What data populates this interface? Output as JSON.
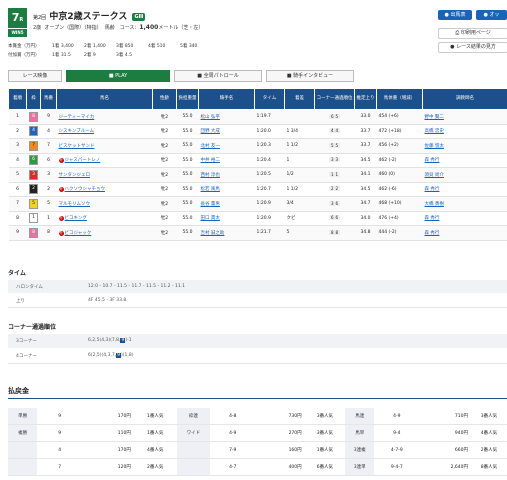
{
  "header": {
    "race_num": "7",
    "race_unit": "R",
    "badge": "WIN5",
    "kai": "第2回",
    "race_name": "中京2歳ステークス",
    "grade": "GⅢ",
    "age": "2歳",
    "cond": "オープン（国際）（特指）",
    "weight": "馬齢",
    "course_label": "コース：",
    "distance": "1,400",
    "unit": "メートル",
    "surface": "（芝・左）",
    "prize_label": "本賞金（万円）",
    "added_label": "付加賞（万円）",
    "prize": [
      {
        "rank": "1着",
        "val": "3,400"
      },
      {
        "rank": "2着",
        "val": "1,400"
      },
      {
        "rank": "3着",
        "val": "850"
      },
      {
        "rank": "4着",
        "val": "510"
      },
      {
        "rank": "5着",
        "val": "340"
      }
    ],
    "added": [
      {
        "rank": "1着",
        "val": "31.5"
      },
      {
        "rank": "2着",
        "val": "9"
      },
      {
        "rank": "3着",
        "val": "4.5"
      }
    ]
  },
  "buttons": {
    "entry": "出馬表",
    "odds": "オッ",
    "print": "印刷用ページ",
    "results_guide": "レース結果の見方"
  },
  "video": {
    "race_video": "レース映像",
    "play": "PLAY",
    "patrol": "全周パトロール",
    "interview": "騎手インタビュー"
  },
  "table": {
    "headers": [
      "着順",
      "枠",
      "馬番",
      "馬名",
      "性齢",
      "負担重量",
      "騎手名",
      "タイム",
      "着差",
      "コーナー通過順位",
      "推定上り",
      "馬体重（増減）",
      "調教師名"
    ],
    "rows": [
      {
        "rank": "1",
        "waku": "8",
        "num": "9",
        "name": "ジーティーマイカ",
        "sex": "牝2",
        "wt": "55.0",
        "jockey": "松山 弘平",
        "time": "1:19.7",
        "diff": "",
        "corner": [
          "6",
          "5"
        ],
        "last3f": "33.0",
        "body": "454 (+6)",
        "trainer": "野中 賢二",
        "icon": ""
      },
      {
        "rank": "2",
        "waku": "4",
        "num": "4",
        "name": "シスキンブルーム",
        "sex": "牝2",
        "wt": "55.0",
        "jockey": "団野 大成",
        "time": "1:20.0",
        "diff": "1 3/4",
        "corner": [
          "4",
          "4"
        ],
        "last3f": "33.7",
        "body": "472 (+18)",
        "trainer": "高橋 忠史",
        "icon": ""
      },
      {
        "rank": "3",
        "waku": "7",
        "num": "7",
        "name": "ビスケットサンド",
        "sex": "牝2",
        "wt": "55.0",
        "jockey": "北村 友一",
        "time": "1:20.3",
        "diff": "1 1/2",
        "corner": [
          "5",
          "5"
        ],
        "last3f": "33.7",
        "body": "456 (+2)",
        "trainer": "佐藤 悠太",
        "icon": ""
      },
      {
        "rank": "4",
        "waku": "6",
        "num": "6",
        "name": "ジャスパートレノ",
        "sex": "牡2",
        "wt": "55.0",
        "jockey": "中井 裕二",
        "time": "1:20.4",
        "diff": "1",
        "corner": [
          "3",
          "3"
        ],
        "last3f": "34.5",
        "body": "462 (-2)",
        "trainer": "森 秀行",
        "icon": "外"
      },
      {
        "rank": "5",
        "waku": "3",
        "num": "3",
        "name": "サンタンジェロ",
        "sex": "牝2",
        "wt": "55.0",
        "jockey": "西村 淳也",
        "time": "1:20.5",
        "diff": "1/2",
        "corner": [
          "1",
          "1"
        ],
        "last3f": "34.1",
        "body": "460 (0)",
        "trainer": "須貝 尚介",
        "icon": ""
      },
      {
        "rank": "6",
        "waku": "2",
        "num": "2",
        "name": "ハクソウシャチョウ",
        "sex": "牝2",
        "wt": "55.0",
        "jockey": "松若 風馬",
        "time": "1:20.7",
        "diff": "1 1/2",
        "corner": [
          "2",
          "2"
        ],
        "last3f": "34.5",
        "body": "462 (-6)",
        "trainer": "森 秀行",
        "icon": "外"
      },
      {
        "rank": "7",
        "waku": "5",
        "num": "5",
        "name": "マルモリムソウ",
        "sex": "牝2",
        "wt": "55.0",
        "jockey": "長谷 薫男",
        "time": "1:20.9",
        "diff": "3/4",
        "corner": [
          "3",
          "6"
        ],
        "last3f": "34.7",
        "body": "468 (+10)",
        "trainer": "大橋 勇樹",
        "icon": ""
      },
      {
        "rank": "8",
        "waku": "1",
        "num": "1",
        "name": "ビコキング",
        "sex": "牡2",
        "wt": "55.0",
        "jockey": "田口 貫太",
        "time": "1:20.9",
        "diff": "クビ",
        "corner": [
          "6",
          "6"
        ],
        "last3f": "34.0",
        "body": "476 (+4)",
        "trainer": "森 秀行",
        "icon": "外"
      },
      {
        "rank": "9",
        "waku": "8",
        "num": "8",
        "name": "ビコジャック",
        "sex": "牡2",
        "wt": "55.0",
        "jockey": "吉村 誠之助",
        "time": "1:21.7",
        "diff": "5",
        "corner": [
          "8",
          "8"
        ],
        "last3f": "34.8",
        "body": "444 (-2)",
        "trainer": "森 秀行",
        "icon": "外"
      }
    ]
  },
  "times": {
    "title": "タイム",
    "halon_label": "ハロンタイム",
    "halon": "12.0 - 10.7 - 11.5 - 11.7 - 11.5 - 11.2 - 11.1",
    "agari_label": "上り",
    "agari": "4F 45.5 - 3F 33.8"
  },
  "corners": {
    "title": "コーナー通過順位",
    "c3_label": "3コーナー",
    "c3_pre": "6,2,5(4,3)(7,8,",
    "c3_hl": "9",
    "c3_post": ")-1",
    "c4_label": "4コーナー",
    "c4_pre": "6(2,5)(4,3,7,",
    "c4_hl": "9",
    "c4_post": ")(1,8)"
  },
  "payout": {
    "title": "払戻金",
    "rows": [
      {
        "t1": "単勝",
        "n1": "9",
        "y1": "170",
        "p1": "1",
        "t2": "枠連",
        "n2": "4-8",
        "y2": "730",
        "p2": "3",
        "t3": "馬連",
        "n3": "4-9",
        "y3": "710",
        "p3": "3"
      },
      {
        "t1": "複勝",
        "n1": "9",
        "y1": "110",
        "p1": "1",
        "t2": "ワイド",
        "n2": "4-9",
        "y2": "270",
        "p2": "3",
        "t3": "馬単",
        "n3": "9-4",
        "y3": "940",
        "p3": "4"
      },
      {
        "t1": "",
        "n1": "4",
        "y1": "170",
        "p1": "4",
        "t2": "",
        "n2": "7-9",
        "y2": "160",
        "p2": "1",
        "t3": "3連複",
        "n3": "4-7-9",
        "y3": "660",
        "p3": "2"
      },
      {
        "t1": "",
        "n1": "7",
        "y1": "120",
        "p1": "2",
        "t2": "",
        "n2": "4-7",
        "y2": "400",
        "p2": "6",
        "t3": "3連単",
        "n3": "9-4-7",
        "y3": "2,640",
        "p3": "8"
      }
    ],
    "yen": "円",
    "pop_suffix": "番人気"
  },
  "colors": {
    "header_blue": "#1d4f8a",
    "green": "#1d7d41",
    "link": "#1b63b5",
    "waku": {
      "1": "#ffffff",
      "2": "#222222",
      "3": "#e0282a",
      "4": "#2262b8",
      "5": "#f2d31b",
      "6": "#2f9b3f",
      "7": "#f08a1c",
      "8": "#f06ea0"
    }
  }
}
